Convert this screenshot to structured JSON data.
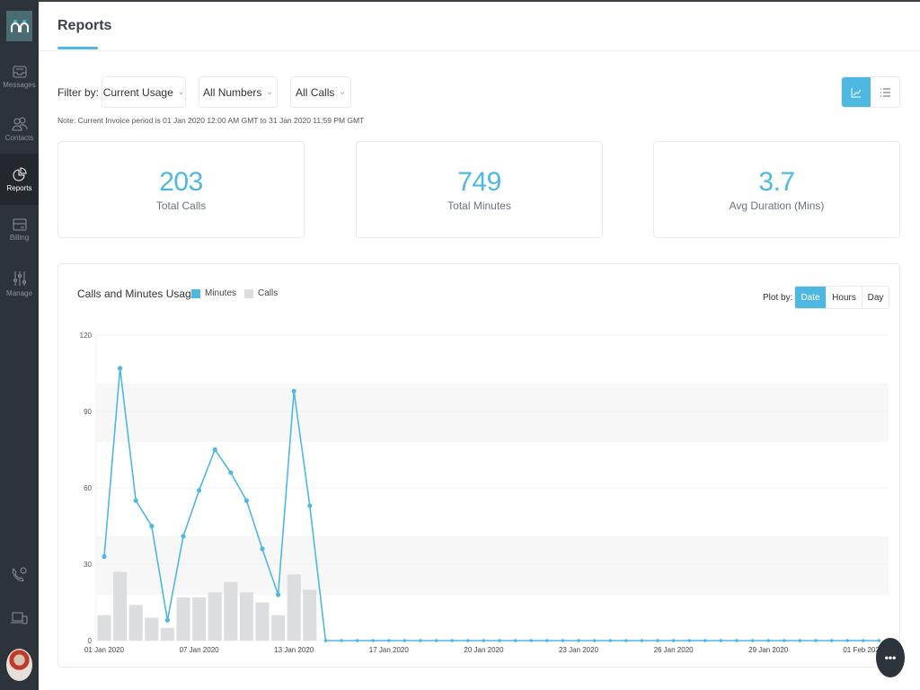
{
  "sidebar": {
    "logo": "nn",
    "items": [
      {
        "label": "Messages",
        "icon": "inbox-icon"
      },
      {
        "label": "Contacts",
        "icon": "contacts-icon"
      },
      {
        "label": "Reports",
        "icon": "pie-chart-icon",
        "active": true
      },
      {
        "label": "Billing",
        "icon": "card-icon"
      },
      {
        "label": "Manage",
        "icon": "sliders-icon"
      }
    ],
    "bottom_icons": [
      "phone-icon",
      "devices-icon"
    ]
  },
  "header": {
    "title": "Reports"
  },
  "filters": {
    "label": "Filter by:",
    "usage": "Current Usage",
    "numbers": "All Numbers",
    "calls": "All Calls",
    "chevron": "⌄",
    "note": "Note: Current Invoice period is 01 Jan 2020 12:00 AM GMT to 31 Jan 2020 11:59 PM GMT"
  },
  "stats": [
    {
      "value": "203",
      "label": "Total Calls"
    },
    {
      "value": "749",
      "label": "Total Minutes"
    },
    {
      "value": "3.7",
      "label": "Avg Duration (Mins)"
    }
  ],
  "chart_panel": {
    "plot_by_label": "Plot by:",
    "plot_options": [
      "Date",
      "Hours",
      "Day"
    ],
    "selected": "Date"
  },
  "colors": {
    "accent": "#4eb8e2",
    "calls_bar": "#dcdde1"
  },
  "chart_data": {
    "type": "bar",
    "title": "Calls and Minutes Usage",
    "legend": [
      "Minutes",
      "Calls"
    ],
    "legend_placement": "top-left",
    "ylim": [
      0,
      120
    ],
    "yticks": [
      0,
      30,
      60,
      90,
      120
    ],
    "x_tick_labels": {
      "0": "01 Jan 2020",
      "6": "07 Jan 2020",
      "12": "13 Jan 2020",
      "18": "17 Jan 2020",
      "24": "20 Jan 2020",
      "30": "23 Jan 2020",
      "36": "26 Jan 2020",
      "42": "29 Jan 2020",
      "48": "01 Feb 2020"
    },
    "point_count": 50,
    "series": [
      {
        "name": "Minutes",
        "type": "line",
        "values": [
          33,
          107,
          55,
          45,
          8,
          41,
          59,
          75,
          66,
          55,
          36,
          18,
          98,
          53,
          0,
          0,
          0,
          0,
          0,
          0,
          0,
          0,
          0,
          0,
          0,
          0,
          0,
          0,
          0,
          0,
          0,
          0,
          0,
          0,
          0,
          0,
          0,
          0,
          0,
          0,
          0,
          0,
          0,
          0,
          0,
          0,
          0,
          0,
          0,
          0
        ]
      },
      {
        "name": "Calls",
        "type": "bar",
        "values": [
          10,
          27,
          14,
          9,
          5,
          17,
          17,
          19,
          23,
          19,
          15,
          10,
          26,
          20,
          0,
          0,
          0,
          0,
          0,
          0,
          0,
          0,
          0,
          0,
          0,
          0,
          0,
          0,
          0,
          0,
          0,
          0,
          0,
          0,
          0,
          0,
          0,
          0,
          0,
          0,
          0,
          0,
          0,
          0,
          0,
          0,
          0,
          0,
          0,
          0
        ]
      }
    ],
    "grid": true
  }
}
